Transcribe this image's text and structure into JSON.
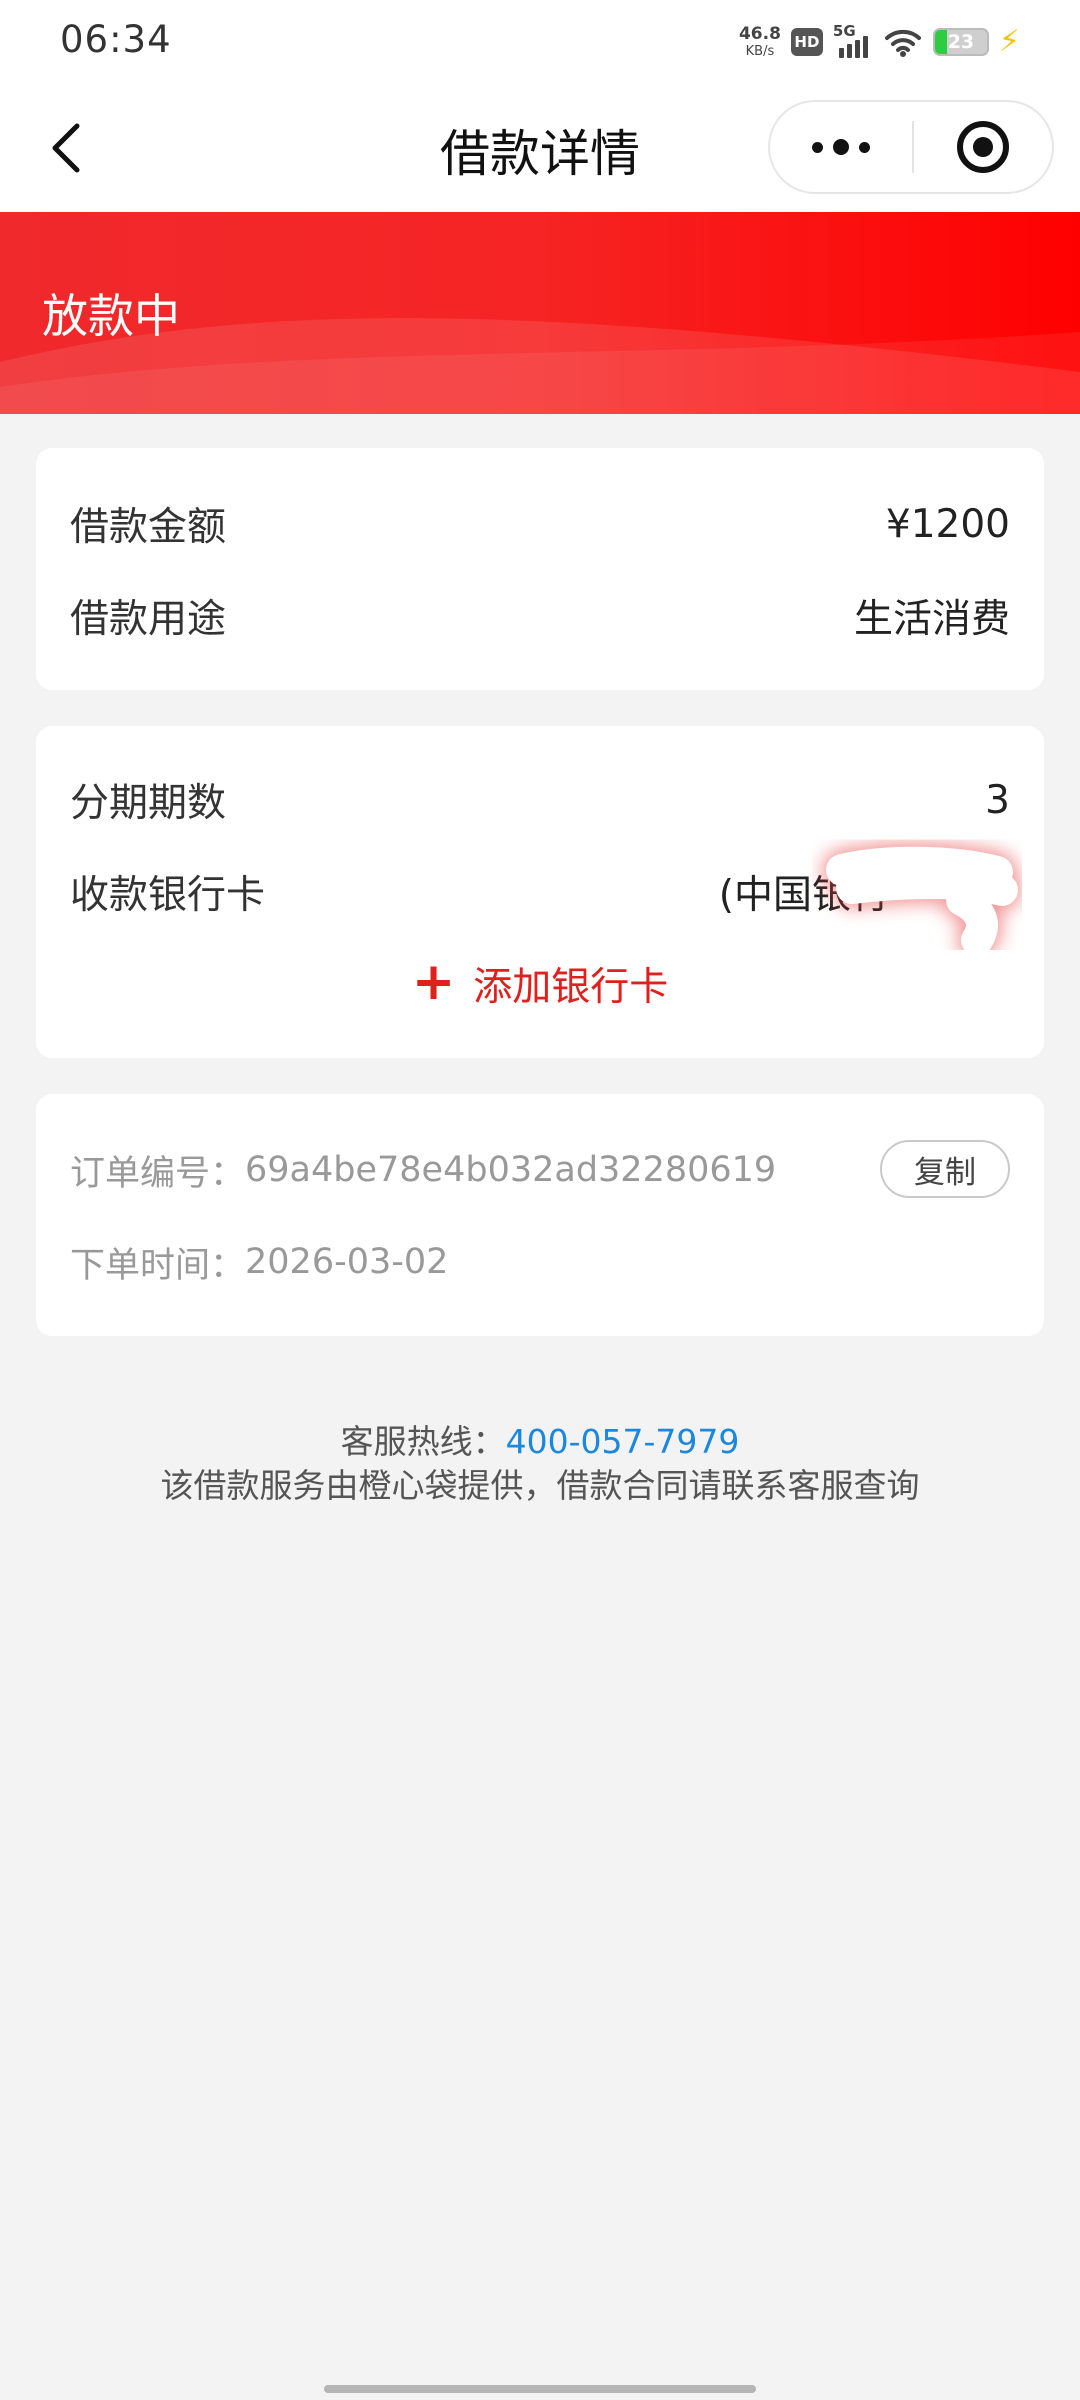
{
  "status_bar": {
    "time": "06:34",
    "net_speed_value": "46.8",
    "net_speed_unit": "KB/s",
    "hd_label": "HD",
    "network_label": "5G",
    "battery_level": "23",
    "battery_percent": 23,
    "battery_color": "#2ecc40",
    "charging_icon": "bolt-icon"
  },
  "nav": {
    "title": "借款详情",
    "back_icon": "chevron-left-icon",
    "more_icon": "more-dots-icon",
    "close_icon": "target-circle-icon"
  },
  "banner": {
    "status": "放款中",
    "color": "#f62424"
  },
  "loan": {
    "amount_label": "借款金额",
    "amount_value": "¥1200",
    "purpose_label": "借款用途",
    "purpose_value": "生活消费"
  },
  "installment": {
    "periods_label": "分期期数",
    "periods_value": "3",
    "bank_label": "收款银行卡",
    "bank_value": "(中国银行",
    "add_card_label": "添加银行卡",
    "accent_color": "#e0201d"
  },
  "order": {
    "number_label": "订单编号：",
    "number_value": "69a4be78e4b032ad32280619",
    "copy_label": "复制",
    "time_label": "下单时间：",
    "time_value": "2026-03-02"
  },
  "footer": {
    "hotline_label": "客服热线：",
    "hotline_number": "400-057-7979",
    "notice": "该借款服务由橙心袋提供，借款合同请联系客服查询",
    "link_color": "#1a88e0"
  }
}
